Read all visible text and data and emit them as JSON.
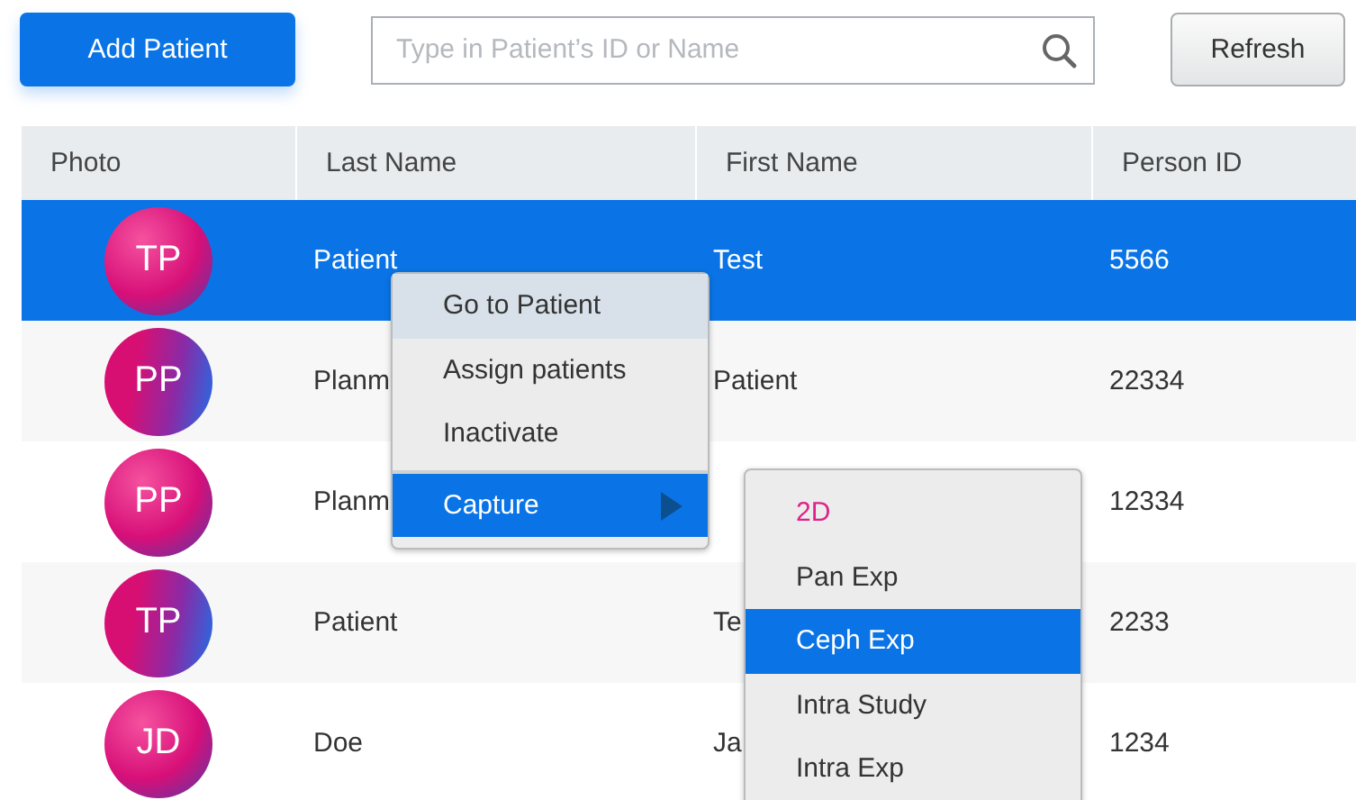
{
  "toolbar": {
    "add_button": "Add Patient",
    "search": {
      "placeholder": "Type in Patient’s ID or Name"
    },
    "refresh_button": "Refresh"
  },
  "table": {
    "columns": [
      "Photo",
      "Last Name",
      "First Name",
      "Person ID"
    ],
    "rows": [
      {
        "initials": "TP",
        "last_name": "Patient",
        "first_name": "Test",
        "person_id": "5566",
        "selected": true
      },
      {
        "initials": "PP",
        "last_name": "Planm",
        "first_name": "Patient",
        "person_id": "22334",
        "selected": false
      },
      {
        "initials": "PP",
        "last_name": "Planm",
        "person_id": "12334",
        "selected": false
      },
      {
        "initials": "TP",
        "last_name": "Patient",
        "first_name": "Te",
        "person_id": "2233",
        "selected": false
      },
      {
        "initials": "JD",
        "last_name": "Doe",
        "first_name": "Ja",
        "person_id": "1234",
        "selected": false
      }
    ]
  },
  "context_menu": {
    "items": [
      {
        "label": "Go to Patient",
        "hovered": true,
        "selected": false
      },
      {
        "label": "Assign patients",
        "hovered": false,
        "selected": false
      },
      {
        "label": "Inactivate",
        "hovered": false,
        "selected": false
      },
      {
        "label": "Capture",
        "hovered": false,
        "selected": true,
        "submenu": true
      }
    ]
  },
  "submenu": {
    "items": [
      {
        "label": "2D",
        "kind": "header",
        "selected": false
      },
      {
        "label": "Pan Exp",
        "kind": "option",
        "selected": false
      },
      {
        "label": "Ceph Exp",
        "kind": "option",
        "selected": true
      },
      {
        "label": "Intra Study",
        "kind": "option",
        "selected": false
      },
      {
        "label": "Intra Exp",
        "kind": "option",
        "selected": false
      }
    ]
  }
}
